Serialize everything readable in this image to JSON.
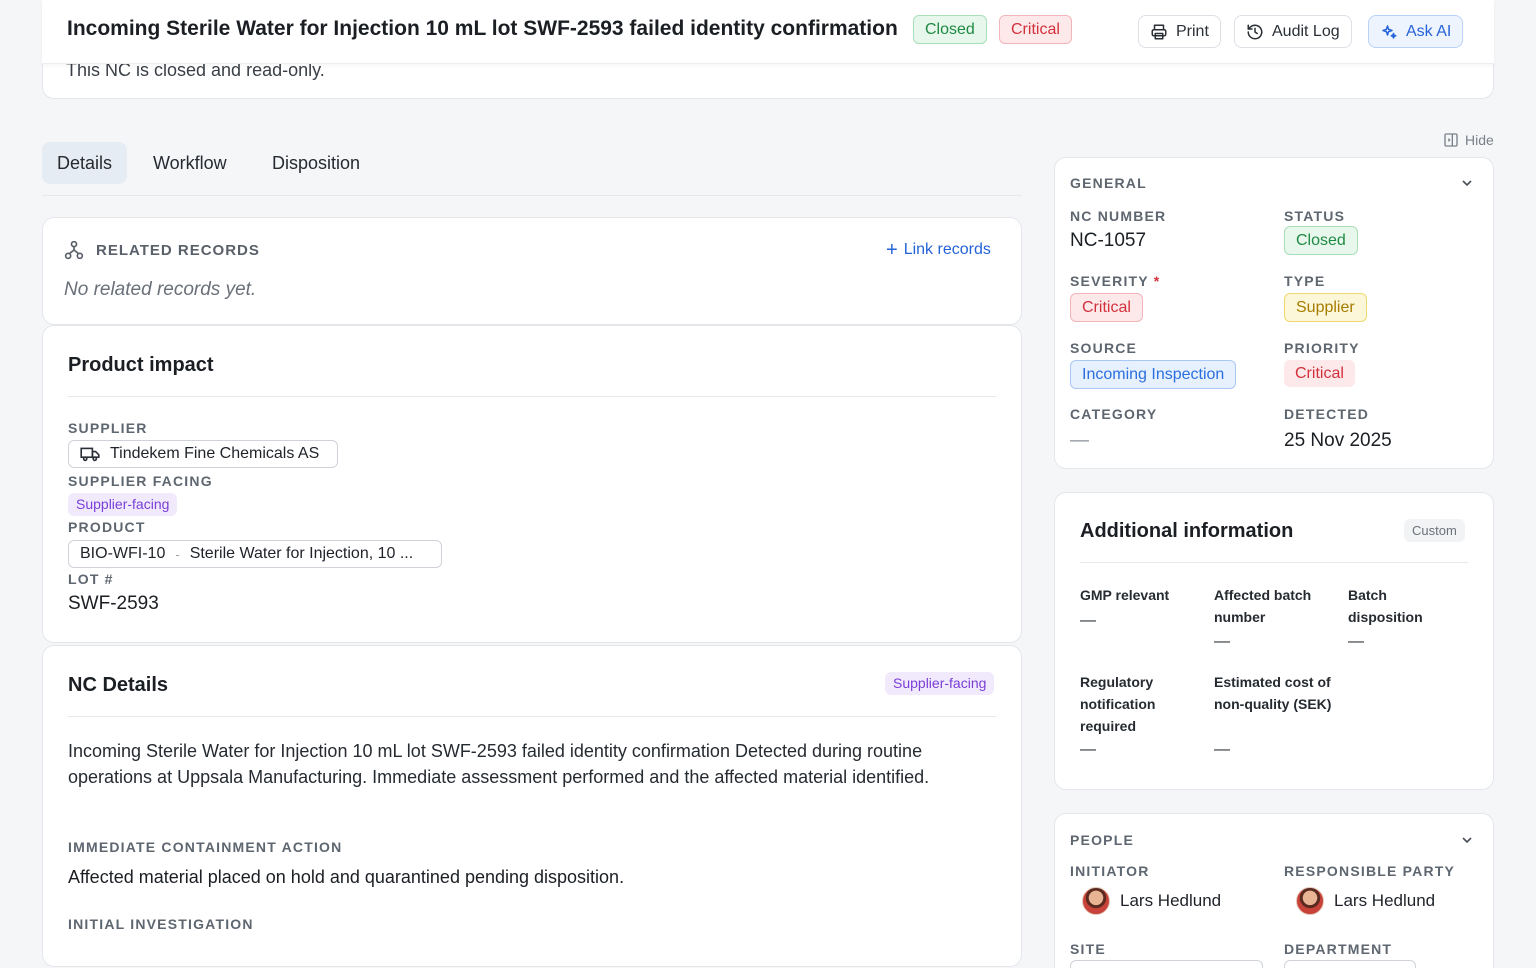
{
  "header": {
    "title": "Incoming Sterile Water for Injection 10 mL lot SWF-2593 failed identity confirmation",
    "status_pill": "Closed",
    "severity_pill": "Critical",
    "print_label": "Print",
    "audit_label": "Audit Log",
    "ai_label": "Ask AI",
    "readonly_notice": "This NC is closed and read-only."
  },
  "tabs": [
    {
      "label": "Details",
      "active": true
    },
    {
      "label": "Workflow",
      "active": false
    },
    {
      "label": "Disposition",
      "active": false
    }
  ],
  "hide_label": "Hide",
  "related": {
    "label": "RELATED RECORDS",
    "link_label": "Link records",
    "empty_text": "No related records yet."
  },
  "product_impact": {
    "title": "Product impact",
    "supplier_label": "SUPPLIER",
    "supplier_value": "Tindekem Fine Chemicals AS",
    "supplier_facing_label": "SUPPLIER FACING",
    "supplier_facing_value": "Supplier-facing",
    "product_label": "PRODUCT",
    "product_code": "BIO-WFI-10",
    "product_sep": "-",
    "product_name": "Sterile Water for Injection, 10 ...",
    "lot_label": "LOT #",
    "lot_value": "SWF-2593"
  },
  "nc_details": {
    "title": "NC Details",
    "tag": "Supplier-facing",
    "description": "Incoming Sterile Water for Injection 10 mL lot SWF-2593 failed identity confirmation Detected during routine operations at Uppsala Manufacturing. Immediate assessment performed and the affected material identified.",
    "containment_label": "IMMEDIATE CONTAINMENT ACTION",
    "containment_value": "Affected material placed on hold and quarantined pending disposition.",
    "investigation_label": "INITIAL INVESTIGATION"
  },
  "general": {
    "section_label": "GENERAL",
    "nc_number_label": "NC NUMBER",
    "nc_number": "NC-1057",
    "status_label": "STATUS",
    "status": "Closed",
    "severity_label": "SEVERITY",
    "required_mark": "*",
    "severity": "Critical",
    "type_label": "TYPE",
    "type": "Supplier",
    "source_label": "SOURCE",
    "source": "Incoming Inspection",
    "priority_label": "PRIORITY",
    "priority": "Critical",
    "category_label": "CATEGORY",
    "category": "—",
    "detected_label": "DETECTED",
    "detected": "25 Nov 2025"
  },
  "additional": {
    "title": "Additional information",
    "tag": "Custom",
    "fields": [
      {
        "label": "GMP relevant",
        "value": "—"
      },
      {
        "label": "Affected batch number",
        "value": "—"
      },
      {
        "label": "Batch disposition",
        "value": "—"
      },
      {
        "label": "Regulatory notification required",
        "value": "—"
      },
      {
        "label": "Estimated cost of non-quality (SEK)",
        "value": "—"
      }
    ]
  },
  "people": {
    "section_label": "PEOPLE",
    "initiator_label": "INITIATOR",
    "initiator": "Lars Hedlund",
    "responsible_label": "RESPONSIBLE PARTY",
    "responsible": "Lars Hedlund",
    "site_label": "SITE",
    "department_label": "DEPARTMENT"
  }
}
